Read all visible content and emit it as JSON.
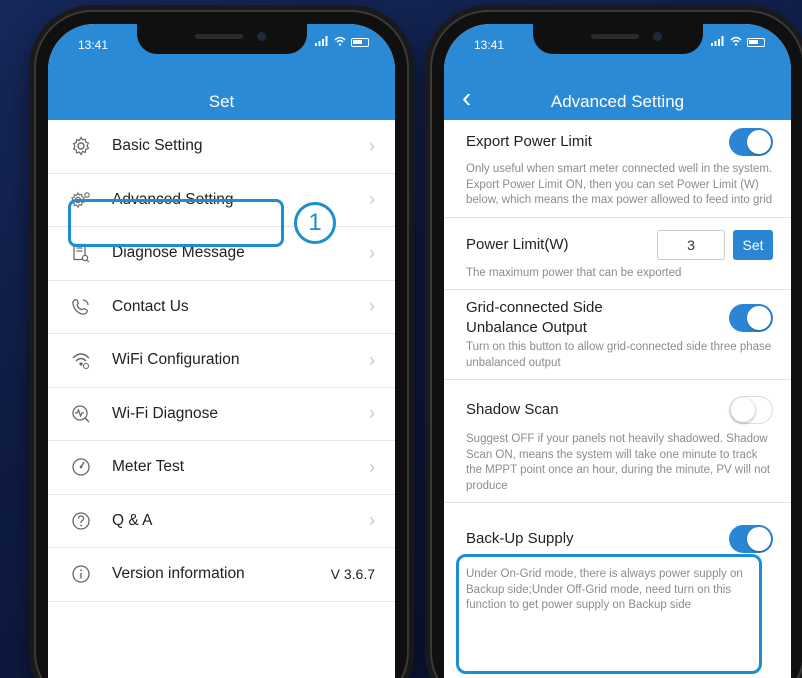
{
  "left_phone": {
    "status_time": "13:41",
    "title": "Set",
    "items": [
      {
        "label": "Basic Setting",
        "icon": "gear-icon"
      },
      {
        "label": "Advanced Setting",
        "icon": "advanced-gear-icon"
      },
      {
        "label": "Diagnose Message",
        "icon": "document-icon"
      },
      {
        "label": "Contact Us",
        "icon": "phone-icon"
      },
      {
        "label": "WiFi Configuration",
        "icon": "wifi-icon"
      },
      {
        "label": "Wi-Fi Diagnose",
        "icon": "wifi-diagnose-icon"
      },
      {
        "label": "Meter Test",
        "icon": "gauge-icon"
      },
      {
        "label": "Q & A",
        "icon": "question-icon"
      },
      {
        "label": "Version information",
        "icon": "info-icon",
        "value": "V 3.6.7"
      }
    ],
    "annotation_number": "1"
  },
  "right_phone": {
    "status_time": "13:41",
    "title": "Advanced Setting",
    "sections": {
      "export_power_limit": {
        "name": "Export Power Limit",
        "enabled": true,
        "desc": "Only useful when smart meter connected well in the system. Export Power Limit ON, then you can set Power Limit (W) below, which means the max power allowed to feed into grid"
      },
      "power_limit": {
        "name": "Power Limit(W)",
        "value": "3",
        "set_label": "Set",
        "desc": "The maximum power that can be exported"
      },
      "unbalance": {
        "name": "Grid-connected Side Unbalance Output",
        "enabled": true,
        "desc": "Turn on this button to allow grid-connected side three phase unbalanced output"
      },
      "shadow_scan": {
        "name": "Shadow Scan",
        "enabled": false,
        "desc": "Suggest OFF if your panels not heavily shadowed. Shadow Scan ON, means the system will take one minute to track the MPPT point once an hour, during the minute, PV will not produce"
      },
      "backup_supply": {
        "name": "Back-Up Supply",
        "enabled": true,
        "desc": "Under On-Grid mode, there is always power supply on Backup side;Under Off-Grid mode, need turn on this function to get power supply on Backup side"
      }
    }
  },
  "colors": {
    "accent": "#2a8ad6",
    "highlight": "#1d8ed1",
    "background": "#12214d"
  }
}
